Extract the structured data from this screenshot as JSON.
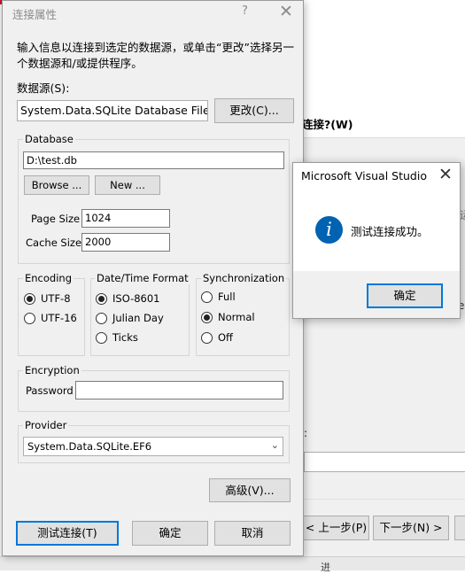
{
  "background_window": {
    "question": "连接?(W)",
    "fragment_right_a": "运",
    "fragment_right_b": "e",
    "colon": ":",
    "prev_button": "< 上一步(P)",
    "next_button": "下一步(N) >",
    "status_fragment": "进"
  },
  "dialog": {
    "title": "连接属性",
    "help_label": "?",
    "close_label": "✕",
    "description": "输入信息以连接到选定的数据源，或单击“更改”选择另一个数据源和/或提供程序。",
    "data_source_label": "数据源(S):",
    "data_source_value": "System.Data.SQLite Database File (.N",
    "change_button": "更改(C)...",
    "database": {
      "group_label": "Database",
      "path": "D:\\test.db",
      "browse_button": "Browse ...",
      "new_button": "New ...",
      "page_size_label": "Page Size",
      "page_size_value": "1024",
      "cache_size_label": "Cache Size",
      "cache_size_value": "2000"
    },
    "encoding": {
      "group_label": "Encoding",
      "options": [
        {
          "label": "UTF-8",
          "selected": true
        },
        {
          "label": "UTF-16",
          "selected": false
        }
      ]
    },
    "datetime": {
      "group_label": "Date/Time Format",
      "options": [
        {
          "label": "ISO-8601",
          "selected": true
        },
        {
          "label": "Julian Day",
          "selected": false
        },
        {
          "label": "Ticks",
          "selected": false
        }
      ]
    },
    "synchronization": {
      "group_label": "Synchronization",
      "options": [
        {
          "label": "Full",
          "selected": false
        },
        {
          "label": "Normal",
          "selected": true
        },
        {
          "label": "Off",
          "selected": false
        }
      ]
    },
    "encryption": {
      "group_label": "Encryption",
      "password_label": "Password",
      "password_value": ""
    },
    "provider": {
      "group_label": "Provider",
      "selected": "System.Data.SQLite.EF6"
    },
    "advanced_button": "高级(V)...",
    "test_button": "测试连接(T)",
    "ok_button": "确定",
    "cancel_button": "取消"
  },
  "message_box": {
    "title": "Microsoft Visual Studio",
    "close_label": "✕",
    "icon_glyph": "i",
    "message": "测试连接成功。",
    "ok_button": "确定"
  },
  "colors": {
    "accent": "#0078d7",
    "info_icon": "#0063b1",
    "error_mark": "#c8102e"
  }
}
